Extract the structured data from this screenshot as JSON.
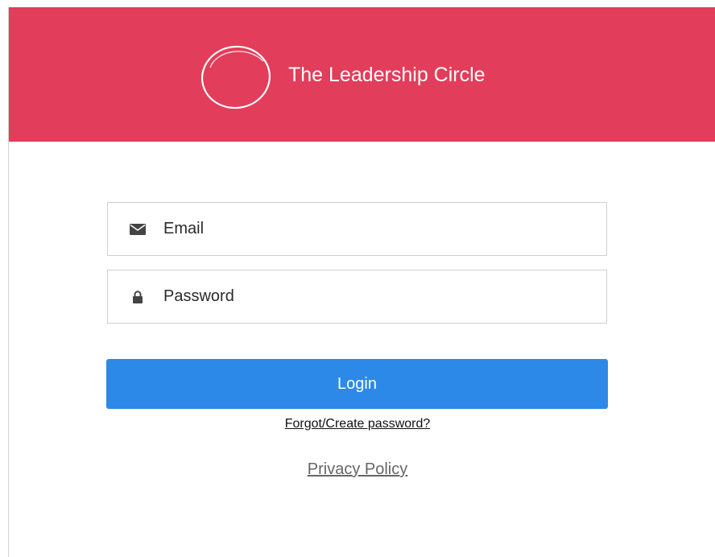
{
  "brand": {
    "name": "The Leadership Circle",
    "logo_icon": "circle-logo-icon",
    "header_color": "#e23d5a"
  },
  "form": {
    "email": {
      "placeholder": "Email",
      "value": "",
      "icon": "envelope-icon"
    },
    "password": {
      "placeholder": "Password",
      "value": "",
      "icon": "lock-icon"
    },
    "login_label": "Login",
    "login_color": "#2d89e8",
    "forgot_label": "Forgot/Create password?"
  },
  "footer": {
    "privacy_label": "Privacy Policy"
  }
}
